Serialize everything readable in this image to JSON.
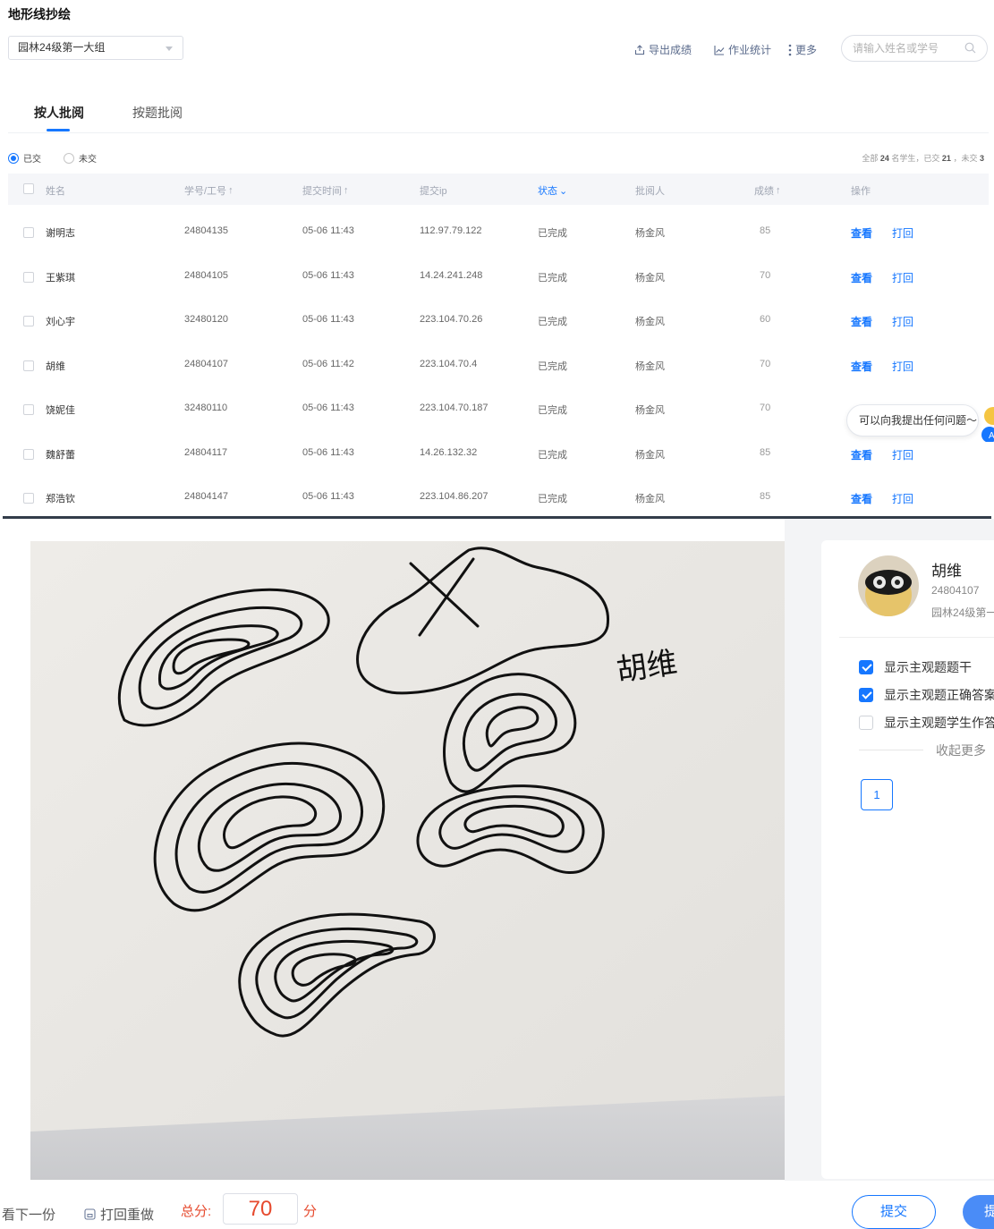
{
  "header": {
    "title": "地形线抄绘",
    "class_select": "园林24级第一大组",
    "actions": {
      "export": "导出成绩",
      "stats": "作业统计",
      "more": "更多"
    },
    "search_placeholder": "请输入姓名或学号"
  },
  "tabs": [
    "按人批阅",
    "按题批阅"
  ],
  "filter": {
    "submitted": "已交",
    "not_submitted": "未交",
    "summary_prefix": "全部",
    "summary_total": "24",
    "summary_students": "名学生，已交",
    "summary_done": "21",
    "summary_mid": "，未交",
    "summary_todo": "3"
  },
  "table": {
    "columns": [
      "姓名",
      "学号/工号",
      "提交时间",
      "提交ip",
      "状态",
      "批阅人",
      "成绩",
      "操作"
    ],
    "rows": [
      {
        "name": "谢明志",
        "id": "24804135",
        "time": "05-06 11:43",
        "ip": "112.97.79.122",
        "status": "已完成",
        "reviewer": "杨金风",
        "score": "85"
      },
      {
        "name": "王紫琪",
        "id": "24804105",
        "time": "05-06 11:43",
        "ip": "14.24.241.248",
        "status": "已完成",
        "reviewer": "杨金风",
        "score": "70"
      },
      {
        "name": "刘心宇",
        "id": "32480120",
        "time": "05-06 11:43",
        "ip": "223.104.70.26",
        "status": "已完成",
        "reviewer": "杨金风",
        "score": "60"
      },
      {
        "name": "胡维",
        "id": "24804107",
        "time": "05-06 11:42",
        "ip": "223.104.70.4",
        "status": "已完成",
        "reviewer": "杨金风",
        "score": "70"
      },
      {
        "name": "饶妮佳",
        "id": "32480110",
        "time": "05-06 11:43",
        "ip": "223.104.70.187",
        "status": "已完成",
        "reviewer": "杨金风",
        "score": "70"
      },
      {
        "name": "魏舒蕾",
        "id": "24804117",
        "time": "05-06 11:43",
        "ip": "14.26.132.32",
        "status": "已完成",
        "reviewer": "杨金风",
        "score": "85"
      },
      {
        "name": "郑浩钦",
        "id": "24804147",
        "time": "05-06 11:43",
        "ip": "223.104.86.207",
        "status": "已完成",
        "reviewer": "杨金风",
        "score": "85"
      }
    ],
    "op_view": "查看",
    "op_return": "打回"
  },
  "assistant": {
    "bubble": "可以向我提出任何问题～"
  },
  "grading": {
    "student_name": "胡维",
    "student_id": "24804107",
    "student_class": "园林24级第一",
    "handwriting": "胡维",
    "options": [
      {
        "label": "显示主观题题干",
        "checked": true
      },
      {
        "label": "显示主观题正确答案",
        "checked": true
      },
      {
        "label": "显示主观题学生作答",
        "checked": false
      }
    ],
    "collapse": "收起更多",
    "page_number": "1",
    "next_label": "看下一份",
    "return_label": "打回重做",
    "total_label": "总分:",
    "score": "70",
    "score_unit": "分",
    "submit_label": "提交",
    "submit_next_label": "提"
  },
  "colors": {
    "accent": "#1677ff",
    "score": "#e64a2e"
  }
}
